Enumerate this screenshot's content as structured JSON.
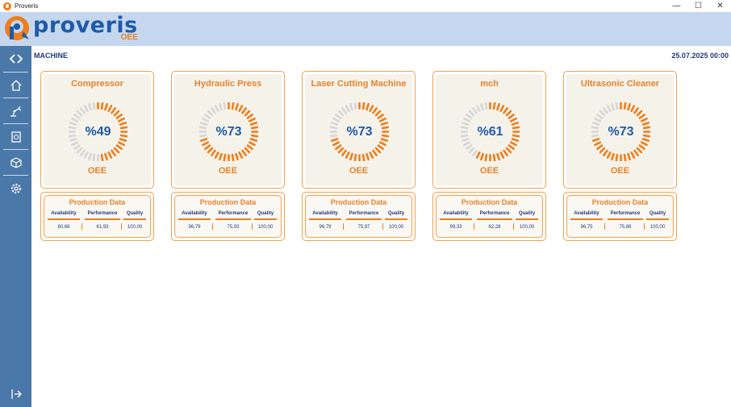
{
  "window": {
    "title": "Proveris",
    "controls": [
      "minimize-icon",
      "maximize-icon",
      "close-icon"
    ]
  },
  "brand": {
    "name": "proveris",
    "sub": "OEE"
  },
  "page": {
    "section_title": "MACHINE",
    "datetime": "25.07.2025 00:00"
  },
  "sidebar": {
    "items": [
      {
        "icon": "expand-arrows-icon"
      },
      {
        "icon": "home-icon"
      },
      {
        "icon": "robot-arm-icon"
      },
      {
        "icon": "report-icon"
      },
      {
        "icon": "box-icon"
      },
      {
        "icon": "settings-icon"
      },
      {
        "icon": "logout-icon"
      }
    ]
  },
  "colors": {
    "accent": "#ef7d1a",
    "brand_blue": "#1f5aa8",
    "sidebar": "#4a78a8",
    "header": "#c5d7ee",
    "gauge_track": "#d6d6d6"
  },
  "machines": [
    {
      "name": "Compressor",
      "oee_text": "%49",
      "oee_value": 49,
      "oee_label": "OEE",
      "production": {
        "title": "Production Data",
        "headers": [
          "Availability",
          "Performance",
          "Quality"
        ],
        "values": [
          "80,68",
          "61,93",
          "100,00"
        ]
      }
    },
    {
      "name": "Hydraulic Press",
      "oee_text": "%73",
      "oee_value": 73,
      "oee_label": "OEE",
      "production": {
        "title": "Production Data",
        "headers": [
          "Availability",
          "Performance",
          "Quality"
        ],
        "values": [
          "96,79",
          "75,93",
          "100,00"
        ]
      }
    },
    {
      "name": "Laser Cutting Machine",
      "oee_text": "%73",
      "oee_value": 73,
      "oee_label": "OEE",
      "production": {
        "title": "Production Data",
        "headers": [
          "Availability",
          "Performance",
          "Quality"
        ],
        "values": [
          "96,79",
          "75,97",
          "100,00"
        ]
      }
    },
    {
      "name": "mch",
      "oee_text": "%61",
      "oee_value": 61,
      "oee_label": "OEE",
      "production": {
        "title": "Production Data",
        "headers": [
          "Availability",
          "Performance",
          "Quality"
        ],
        "values": [
          "99,33",
          "62,28",
          "100,00"
        ]
      }
    },
    {
      "name": "Ultrasonic Cleaner",
      "oee_text": "%73",
      "oee_value": 73,
      "oee_label": "OEE",
      "production": {
        "title": "Production Data",
        "headers": [
          "Availability",
          "Performance",
          "Quality"
        ],
        "values": [
          "96,75",
          "75,88",
          "100,00"
        ]
      }
    }
  ]
}
